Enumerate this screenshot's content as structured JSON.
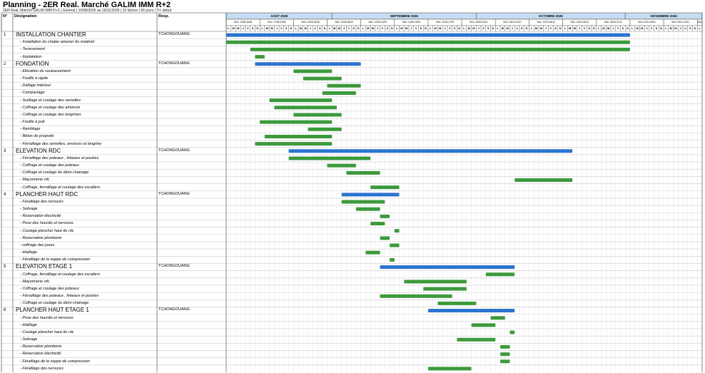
{
  "title": "Planning - 2ER Real. Marché GALIM IMM R+2",
  "subtitle": "2ER Real. Marché GALIM IMM R+2 | Général | 10/08/2026 au 16/11/2026 | 10 tâches | 66 jours | Tri: début",
  "headers": {
    "num": "N°",
    "designation": "Désignation",
    "resp": "Resp."
  },
  "colors": {
    "summary_bar": "#2a74cf",
    "task_bar": "#3c9a3c",
    "month_fill": "#c6dcf3",
    "grid": "#cccccc",
    "border": "#555555"
  },
  "months": [
    {
      "label": "AOÛT 2026",
      "days": 22
    },
    {
      "label": "SEPTEMBRE 2026",
      "days": 30
    },
    {
      "label": "OCTOBRE 2026",
      "days": 31
    },
    {
      "label": "NOVEMBRE 2026",
      "days": 16
    }
  ],
  "weeks": [
    "Sem. 10/08-16/08",
    "Sem. 17/08-23/08",
    "Sem. 24/08-30/08",
    "Sem. 31/08-06/09",
    "Sem. 07/09-13/09",
    "Sem. 14/09-20/09",
    "Sem. 21/09-27/09",
    "Sem. 28/09-04/10",
    "Sem. 05/10-11/10",
    "Sem. 12/10-18/10",
    "Sem. 19/10-25/10",
    "Sem. 26/10-01/11",
    "Sem. 02/11-08/11",
    "Sem. 09/11-15/11",
    "Sem. 16/11-22/11"
  ],
  "day_letters": [
    "L",
    "M",
    "M",
    "J",
    "V",
    "S",
    "D"
  ],
  "rows": [
    {
      "num": "1",
      "name": "INSTALLATION CHANTIER",
      "resp": "TCHONGOUANG",
      "type": "summary",
      "start": 0,
      "dur": 84
    },
    {
      "name": "- Installation du chatier amener du matériel",
      "type": "task",
      "start": 0,
      "dur": 84
    },
    {
      "name": "- Terassement",
      "type": "task",
      "start": 5,
      "dur": 79
    },
    {
      "name": "- Implatation",
      "type": "task",
      "start": 6,
      "dur": 2
    },
    {
      "num": "2",
      "name": "FONDATION",
      "resp": "TCHONGOUANG",
      "type": "summary",
      "start": 6,
      "dur": 22
    },
    {
      "name": "- Elévation du soubassement",
      "type": "task",
      "start": 14,
      "dur": 8
    },
    {
      "name": "- Fouille à rigole",
      "type": "task",
      "start": 16,
      "dur": 8
    },
    {
      "name": "- Dallage intérieur",
      "type": "task",
      "start": 21,
      "dur": 7
    },
    {
      "name": "- Compactage",
      "type": "task",
      "start": 20,
      "dur": 7
    },
    {
      "name": "- Scéllage et coulage des  semelles",
      "type": "task",
      "start": 9,
      "dur": 13
    },
    {
      "name": "- Coffrage et coulage des amorces",
      "type": "task",
      "start": 10,
      "dur": 13
    },
    {
      "name": "- Coffrage et coulage des longrines",
      "type": "task",
      "start": 14,
      "dur": 10
    },
    {
      "name": "- Fouille à puit",
      "type": "task",
      "start": 7,
      "dur": 15
    },
    {
      "name": "- Remblage",
      "type": "task",
      "start": 17,
      "dur": 7
    },
    {
      "name": "- Béton de propreté",
      "type": "task",
      "start": 8,
      "dur": 14
    },
    {
      "name": "- Férraillage des semelles, amorces et longrine",
      "type": "task",
      "start": 6,
      "dur": 16
    },
    {
      "num": "3",
      "name": "ELEVATION RDC",
      "resp": "TCHONGOUANG",
      "type": "summary",
      "start": 13,
      "dur": 59
    },
    {
      "name": "- Férraillage des poteaux , linteaux et poutres",
      "type": "task",
      "start": 13,
      "dur": 17
    },
    {
      "name": "- Coffrage et coulage des poteaux",
      "type": "task",
      "start": 21,
      "dur": 6
    },
    {
      "name": "- Coffrage et coulage du démi chainage",
      "type": "task",
      "start": 25,
      "dur": 7
    },
    {
      "name": "- Maçonnerie rdc",
      "type": "task",
      "start": 60,
      "dur": 12
    },
    {
      "name": "- Coffrage, ferraillage et coulage des escaliers",
      "type": "task",
      "start": 30,
      "dur": 6
    },
    {
      "num": "4",
      "name": "PLANCHER HAUT RDC",
      "resp": "TCHONGOUANG",
      "type": "summary",
      "start": 24,
      "dur": 12
    },
    {
      "name": "- Féraillage des nervures",
      "type": "task",
      "start": 24,
      "dur": 9
    },
    {
      "name": "- Solivage",
      "type": "task",
      "start": 27,
      "dur": 5
    },
    {
      "name": "- Reservation électricité",
      "type": "task",
      "start": 32,
      "dur": 2
    },
    {
      "name": "- Pose des hourdis et nervures",
      "type": "task",
      "start": 30,
      "dur": 3
    },
    {
      "name": "- Coulage plancher haut du rdc",
      "type": "task",
      "start": 35,
      "dur": 1
    },
    {
      "name": "- Reservation plomberie",
      "type": "task",
      "start": 32,
      "dur": 2
    },
    {
      "name": "- coffrage des joues",
      "type": "task",
      "start": 34,
      "dur": 2
    },
    {
      "name": "- étaillage",
      "type": "task",
      "start": 29,
      "dur": 3
    },
    {
      "name": "- Féraillage de la nappe de compression",
      "type": "task",
      "start": 34,
      "dur": 1
    },
    {
      "num": "5",
      "name": "ELEVATION ETAGE 1",
      "resp": "TCHONGOUANG",
      "type": "summary",
      "start": 32,
      "dur": 28
    },
    {
      "name": "- Coffrage, ferraillage et coulage des escaliers",
      "type": "task",
      "start": 54,
      "dur": 6
    },
    {
      "name": "- Maçonnerie rdc",
      "type": "task",
      "start": 37,
      "dur": 13
    },
    {
      "name": "- Coffrage et coulage des poteaux",
      "type": "task",
      "start": 41,
      "dur": 9
    },
    {
      "name": "- Férraillage des poteaux , linteaux et poutres",
      "type": "task",
      "start": 32,
      "dur": 15
    },
    {
      "name": "- Coffrage et coulage du démi chainage",
      "type": "task",
      "start": 44,
      "dur": 8
    },
    {
      "num": "6",
      "name": "PLANCHER HAUT ETAGE 1",
      "resp": "TCHONGOUANG",
      "type": "summary",
      "start": 42,
      "dur": 18
    },
    {
      "name": "- Pose des hourdis et nervures",
      "type": "task",
      "start": 55,
      "dur": 3
    },
    {
      "name": "- étaillage",
      "type": "task",
      "start": 51,
      "dur": 5
    },
    {
      "name": "- Coulage plancher haut du rdc",
      "type": "task",
      "start": 59,
      "dur": 1
    },
    {
      "name": "- Solivage",
      "type": "task",
      "start": 48,
      "dur": 8
    },
    {
      "name": "- Reservation plomberie",
      "type": "task",
      "start": 57,
      "dur": 2
    },
    {
      "name": "- Reservation électricité",
      "type": "task",
      "start": 57,
      "dur": 2
    },
    {
      "name": "- Féraillage de la nappe de compression",
      "type": "task",
      "start": 57,
      "dur": 2
    },
    {
      "name": "- Féraillage des nervures",
      "type": "task",
      "start": 42,
      "dur": 9
    }
  ]
}
